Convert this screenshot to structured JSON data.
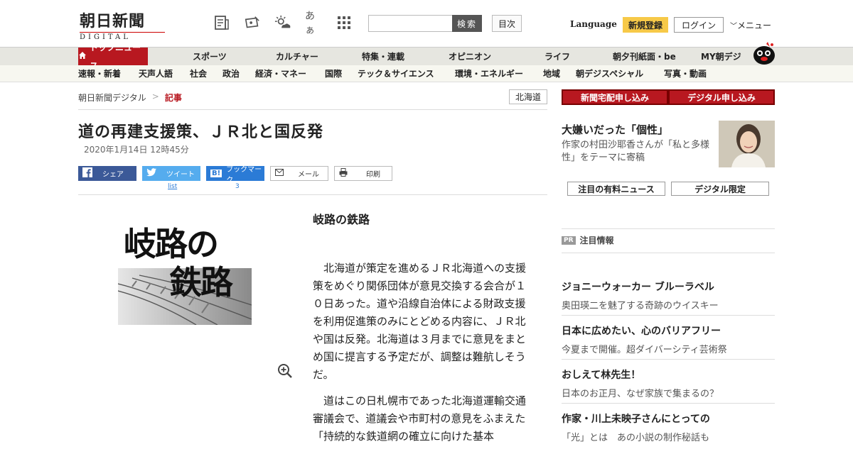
{
  "header": {
    "logo_main": "朝日新聞",
    "logo_sub": "DIGITAL",
    "search_placeholder": "",
    "search_label": "検索",
    "index_label": "目次",
    "language_label": "Language",
    "register_label": "新規登録",
    "login_label": "ログイン",
    "menu_label": "メニュー",
    "font_size_label": "あぁ"
  },
  "nav_primary": {
    "items": [
      "トップニュース",
      "スポーツ",
      "カルチャー",
      "特集・連載",
      "オピニオン",
      "ライフ",
      "朝夕刊紙面・be",
      "MY朝デジ"
    ]
  },
  "nav_secondary": {
    "items": [
      "速報・新着",
      "天声人語",
      "社会",
      "政治",
      "経済・マネー",
      "国際",
      "テック＆サイエンス",
      "環境・エネルギー",
      "地域",
      "朝デジスペシャル",
      "写真・動画"
    ]
  },
  "breadcrumb": {
    "home": "朝日新聞デジタル",
    "separator": ">",
    "current": "記事"
  },
  "region_tag": "北海道",
  "article": {
    "title": "道の再建支援策、ＪＲ北と国反発",
    "date": "2020年1月14日 12時45分",
    "image_text_1": "岐路の",
    "image_text_2": "鉄路",
    "series_title": "岐路の鉄路",
    "paragraphs": [
      "北海道が策定を進めるＪＲ北海道への支援策をめぐり関係団体が意見交換する会合が１０日あった。道や沿線自治体による財政支援を利用促進策のみにとどめる内容に、ＪＲ北や国は反発。北海道は３月までに意見をまとめ国に提言する予定だが、調整は難航しそうだ。",
      "道はこの日札幌市であった北海道運輸交通審議会で、道議会や市町村の意見をふまえた「持続的な鉄道網の確立に向けた基本"
    ]
  },
  "share": {
    "facebook": "シェア",
    "twitter": "ツイート",
    "hatena": "ブックマーク",
    "mail": "メール",
    "print": "印刷",
    "twitter_count": "list",
    "hatena_count": "3"
  },
  "sidebar": {
    "btn_home_delivery": "新聞宅配申し込み",
    "btn_digital": "デジタル申し込み",
    "feature_title": "大嫌いだった「個性」",
    "feature_desc": "作家の村田沙耶香さんが「私と多様性」をテーマに寄稿",
    "tab_paid_news": "注目の有料ニュース",
    "tab_digital_only": "デジタル限定",
    "pr_tag": "PR",
    "pr_heading": "注目情報",
    "promos": [
      {
        "title": "ジョニーウォーカー ブルーラベル",
        "desc": "奥田瑛二を魅了する奇跡のウイスキー"
      },
      {
        "title": "日本に広めたい、心のバリアフリー",
        "desc": "今夏まで開催。超ダイバーシティ芸術祭"
      },
      {
        "title": "おしえて林先生！",
        "desc": "日本のお正月、なぜ家族で集まるの？"
      },
      {
        "title": "作家・川上未映子さんにとっての",
        "desc": "「光」とは　あの小説の制作秘話も"
      }
    ]
  },
  "colors": {
    "brand_red": "#b81820",
    "register_yellow": "#f7c948",
    "facebook": "#3b5998",
    "twitter": "#55acee",
    "hatena": "#2b7bd6"
  }
}
